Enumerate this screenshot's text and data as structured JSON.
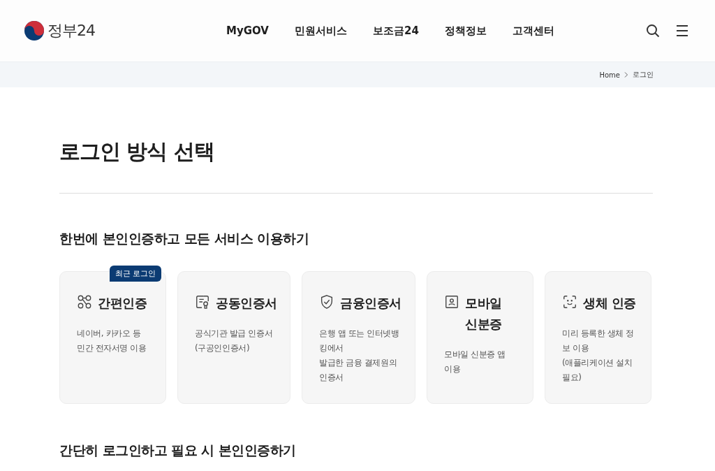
{
  "header": {
    "logo_text": "정부24",
    "nav": [
      "MyGOV",
      "민원서비스",
      "보조금24",
      "정책정보",
      "고객센터"
    ]
  },
  "breadcrumb": {
    "items": [
      "Home",
      "로그인"
    ]
  },
  "page_title": "로그인 방식 선택",
  "section_title": "한번에 본인인증하고 모든 서비스 이용하기",
  "methods": [
    {
      "kind": "simple",
      "title": "간편인증",
      "badge": "최근 로그인",
      "description": "네이버, 카카오 등\n민간 전자서명 이용"
    },
    {
      "kind": "joint",
      "title": "공동인증서",
      "description": "공식기관 발급 인증서\n(구공인인증서)"
    },
    {
      "kind": "financial",
      "title": "금융인증서",
      "description": "은행 앱 또는 인터넷뱅\n킹에서\n발급한 금융 결제원의\n인증서"
    },
    {
      "kind": "mobile",
      "title": "모바일\n신분증",
      "description": "모바일 신분증 앱\n이용"
    },
    {
      "kind": "bio",
      "title": "생체 인증",
      "description": "미리 등록한 생체 정\n보 이용\n(애플리케이션 설치\n필요)"
    }
  ],
  "section2_title": "간단히 로그인하고 필요 시 본인인증하기"
}
